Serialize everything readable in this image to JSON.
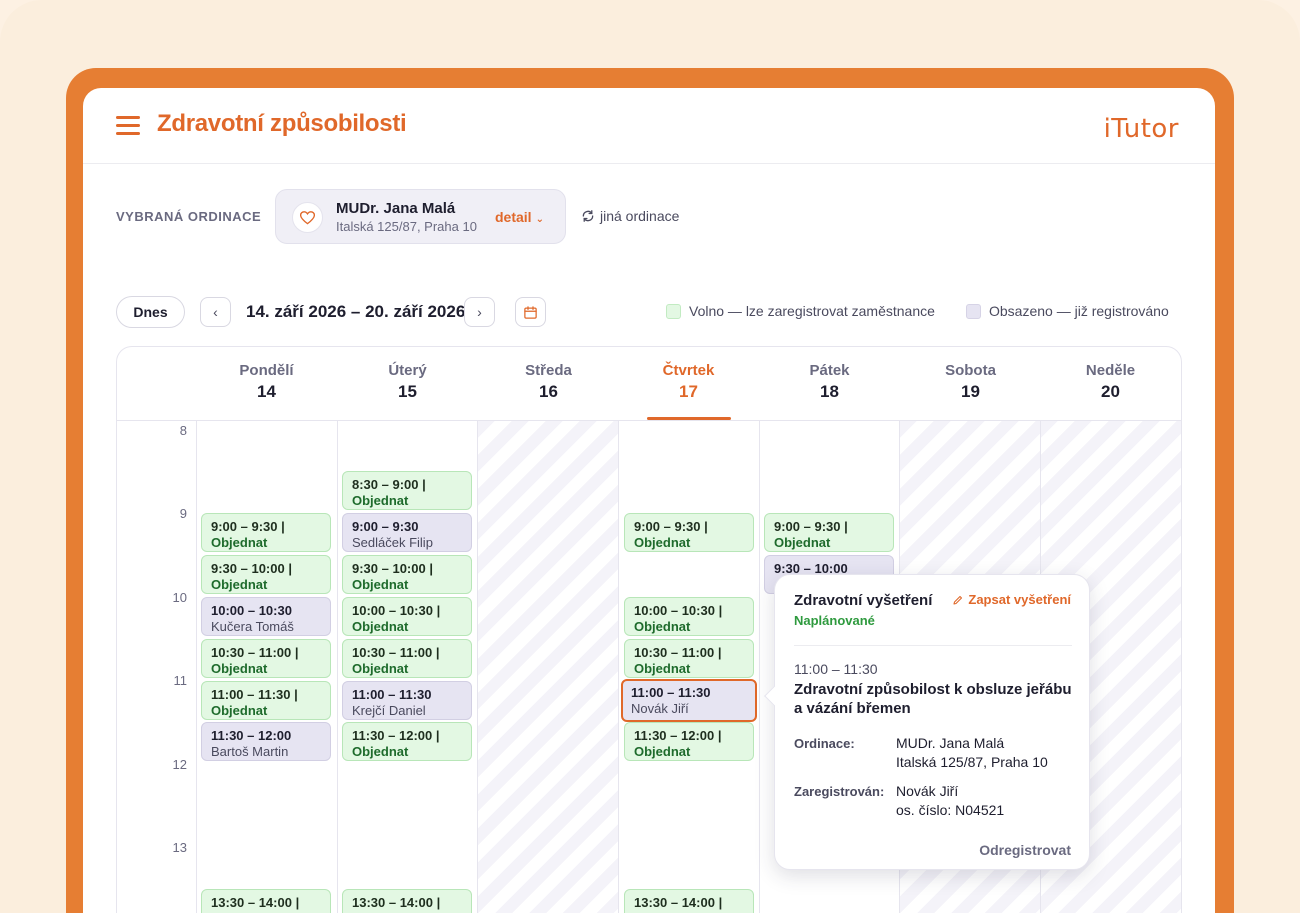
{
  "app": {
    "title": "Zdravotní způsobilosti",
    "logo": "iTutor",
    "accent_color": "#e0682a"
  },
  "ordinace": {
    "label": "VYBRANÁ ORDINACE",
    "doctor": "MUDr. Jana Malá",
    "address": "Italská 125/87, Praha 10",
    "detail_label": "detail",
    "other_label": "jiná ordinace"
  },
  "nav": {
    "today_label": "Dnes",
    "date_range": "14. září 2026 – 20. září 2026"
  },
  "legend": {
    "free": "Volno — lze zaregistrovat zaměstnance",
    "taken": "Obsazeno — již registrováno",
    "free_color": "#e3f8e3",
    "taken_color": "#e6e4f2"
  },
  "days": [
    {
      "name": "Pondělí",
      "num": "14"
    },
    {
      "name": "Úterý",
      "num": "15"
    },
    {
      "name": "Středa",
      "num": "16"
    },
    {
      "name": "Čtvrtek",
      "num": "17"
    },
    {
      "name": "Pátek",
      "num": "18"
    },
    {
      "name": "Sobota",
      "num": "19"
    },
    {
      "name": "Neděle",
      "num": "20"
    }
  ],
  "hours": [
    "8",
    "9",
    "10",
    "11",
    "12",
    "13"
  ],
  "slots": {
    "mon": [
      {
        "time": "9:00 – 9:30 |",
        "sub": "Objednat"
      },
      {
        "time": "9:30 – 10:00 |",
        "sub": "Objednat"
      },
      {
        "time": "10:00 – 10:30",
        "sub": "Kučera Tomáš"
      },
      {
        "time": "10:30 – 11:00 |",
        "sub": "Objednat"
      },
      {
        "time": "11:00 – 11:30 |",
        "sub": "Objednat"
      },
      {
        "time": "11:30 – 12:00",
        "sub": "Bartoš Martin"
      },
      {
        "time": "13:30 – 14:00 |",
        "sub": ""
      }
    ],
    "tue": [
      {
        "time": "8:30 – 9:00 |",
        "sub": "Objednat"
      },
      {
        "time": "9:00 – 9:30",
        "sub": "Sedláček Filip"
      },
      {
        "time": "9:30 – 10:00 |",
        "sub": "Objednat"
      },
      {
        "time": "10:00 – 10:30 |",
        "sub": "Objednat"
      },
      {
        "time": "10:30 – 11:00 |",
        "sub": "Objednat"
      },
      {
        "time": "11:00 – 11:30",
        "sub": "Krejčí Daniel"
      },
      {
        "time": "11:30 – 12:00 |",
        "sub": "Objednat"
      },
      {
        "time": "13:30 – 14:00 |",
        "sub": ""
      }
    ],
    "thu": [
      {
        "time": "9:00 – 9:30 |",
        "sub": "Objednat"
      },
      {
        "time": "10:00 – 10:30 |",
        "sub": "Objednat"
      },
      {
        "time": "10:30 – 11:00 |",
        "sub": "Objednat"
      },
      {
        "time": "11:00 – 11:30",
        "sub": "Novák Jiří"
      },
      {
        "time": "11:30 – 12:00 |",
        "sub": "Objednat"
      },
      {
        "time": "13:30 – 14:00 |",
        "sub": ""
      }
    ],
    "fri": [
      {
        "time": "9:00 – 9:30 |",
        "sub": "Objednat"
      },
      {
        "time": "9:30 – 10:00",
        "sub": ""
      }
    ]
  },
  "popover": {
    "title": "Zdravotní vyšetření",
    "action": "Zapsat vyšetření",
    "status": "Naplánované",
    "time": "11:00 – 11:30",
    "exam": "Zdravotní způsobilost k obsluze jeřábu a vázání břemen",
    "ordinace_label": "Ordinace:",
    "ordinace_name": "MUDr. Jana Malá",
    "ordinace_addr": "Italská 125/87, Praha 10",
    "registered_label": "Zaregistrován:",
    "registered_name": "Novák Jiří",
    "registered_id": "os. číslo: N04521",
    "unregister": "Odregistrovat"
  }
}
